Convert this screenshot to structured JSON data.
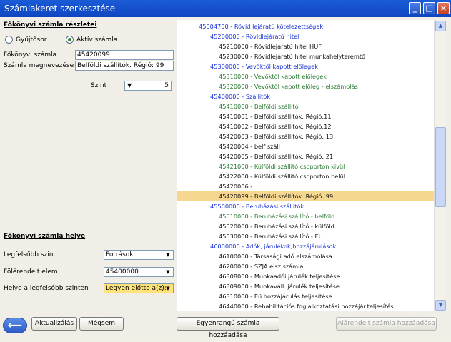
{
  "window": {
    "title": "Számlakeret szerkesztése"
  },
  "details": {
    "heading": "Főkönyvi számla részletei",
    "radio_collector": "Gyűjtősor",
    "radio_active": "Aktív számla",
    "account_label": "Főkönyvi számla",
    "account_value": "45420099",
    "name_label": "Számla megnevezése",
    "name_value": "Belföldi szállítók. Régió: 99",
    "level_label": "Szint",
    "level_value": "5"
  },
  "placement": {
    "heading": "Főkönyvi számla helye",
    "top_label": "Legfelsőbb szint",
    "top_value": "Források",
    "parent_label": "Fölérendelt elem",
    "parent_value": "45400000",
    "position_label": "Helye a legfelsőbb szinten",
    "position_value": "Legyen előtte a(z):"
  },
  "tree": [
    {
      "text": "45004700 - Rövid lejáratú kötelezettségek",
      "color": "#1a33d6",
      "indent": 30
    },
    {
      "text": "45200000 - Rövidlejáratú hitel",
      "color": "#1a33d6",
      "indent": 46
    },
    {
      "text": "45210000 - Rövidlejáratú hitel HUF",
      "color": "#111111",
      "indent": 58
    },
    {
      "text": "45230000 - Rövidlejáratú hitel munkahelyteremtő",
      "color": "#111111",
      "indent": 58
    },
    {
      "text": "45300000 - Vevőktől kapott előlegek",
      "color": "#1a33d6",
      "indent": 46
    },
    {
      "text": "45310000 - Vevőktől kapott előlegek",
      "color": "#2a7a32",
      "indent": 58
    },
    {
      "text": "45320000 - Vevőktől kapott előleg - elszámolás",
      "color": "#2a7a32",
      "indent": 58
    },
    {
      "text": "45400000 - Szállítók",
      "color": "#1a33d6",
      "indent": 46
    },
    {
      "text": "45410000 - Belföldi szállító",
      "color": "#2a7a32",
      "indent": 58
    },
    {
      "text": "45410001 - Belföldi szállítók. Régió:11",
      "color": "#111111",
      "indent": 58
    },
    {
      "text": "45410002 - Belföldi szállítók. Régió:12",
      "color": "#111111",
      "indent": 58
    },
    {
      "text": "45420003 - Belföldi szállítók. Régió: 13",
      "color": "#111111",
      "indent": 58
    },
    {
      "text": "45420004 - belf száll",
      "color": "#111111",
      "indent": 58
    },
    {
      "text": "45420005 - Belföldi szállítók. Régió: 21",
      "color": "#111111",
      "indent": 58
    },
    {
      "text": "45421000 - Külföldi szállító csoporton kívül",
      "color": "#2a7a32",
      "indent": 58
    },
    {
      "text": "45422000 - Külföldi szállító csoporton belül",
      "color": "#111111",
      "indent": 58
    },
    {
      "text": "45420006 -",
      "color": "#111111",
      "indent": 58
    },
    {
      "text": "45420099 - Belföldi szállítók. Régió: 99",
      "color": "#111111",
      "indent": 58,
      "selected": true
    },
    {
      "text": "45500000 - Beruházási szállítók",
      "color": "#1a33d6",
      "indent": 46
    },
    {
      "text": "45510000 - Beruházási szállító - belföld",
      "color": "#2a7a32",
      "indent": 58
    },
    {
      "text": "45520000 - Beruházási szállító - külföld",
      "color": "#111111",
      "indent": 58
    },
    {
      "text": "45530000 - Beruházási szállító - EU",
      "color": "#111111",
      "indent": 58
    },
    {
      "text": "46000000 - Adók, járulékok,hozzájárulások",
      "color": "#1a33d6",
      "indent": 46
    },
    {
      "text": "46100000 - Társasági adó elszámolása",
      "color": "#111111",
      "indent": 58
    },
    {
      "text": "46200000 - SZJA elsz.számla",
      "color": "#111111",
      "indent": 58
    },
    {
      "text": "46308000 - Munkaadói járulék teljesítése",
      "color": "#111111",
      "indent": 58
    },
    {
      "text": "46309000 - Munkaváll. járulék teljesítése",
      "color": "#111111",
      "indent": 58
    },
    {
      "text": "46310000 - Eü.hozzájárulás teljesítése",
      "color": "#111111",
      "indent": 58
    },
    {
      "text": "46440000 - Rehabilitációs foglalkoztatási hozzájár.teljesítés",
      "color": "#111111",
      "indent": 58
    }
  ],
  "buttons": {
    "update": "Aktualizálás",
    "cancel": "Mégsem",
    "add_sibling": "Egyenrangú számla hozzáadása",
    "add_child": "Alárendelt számla hozzáadása"
  }
}
